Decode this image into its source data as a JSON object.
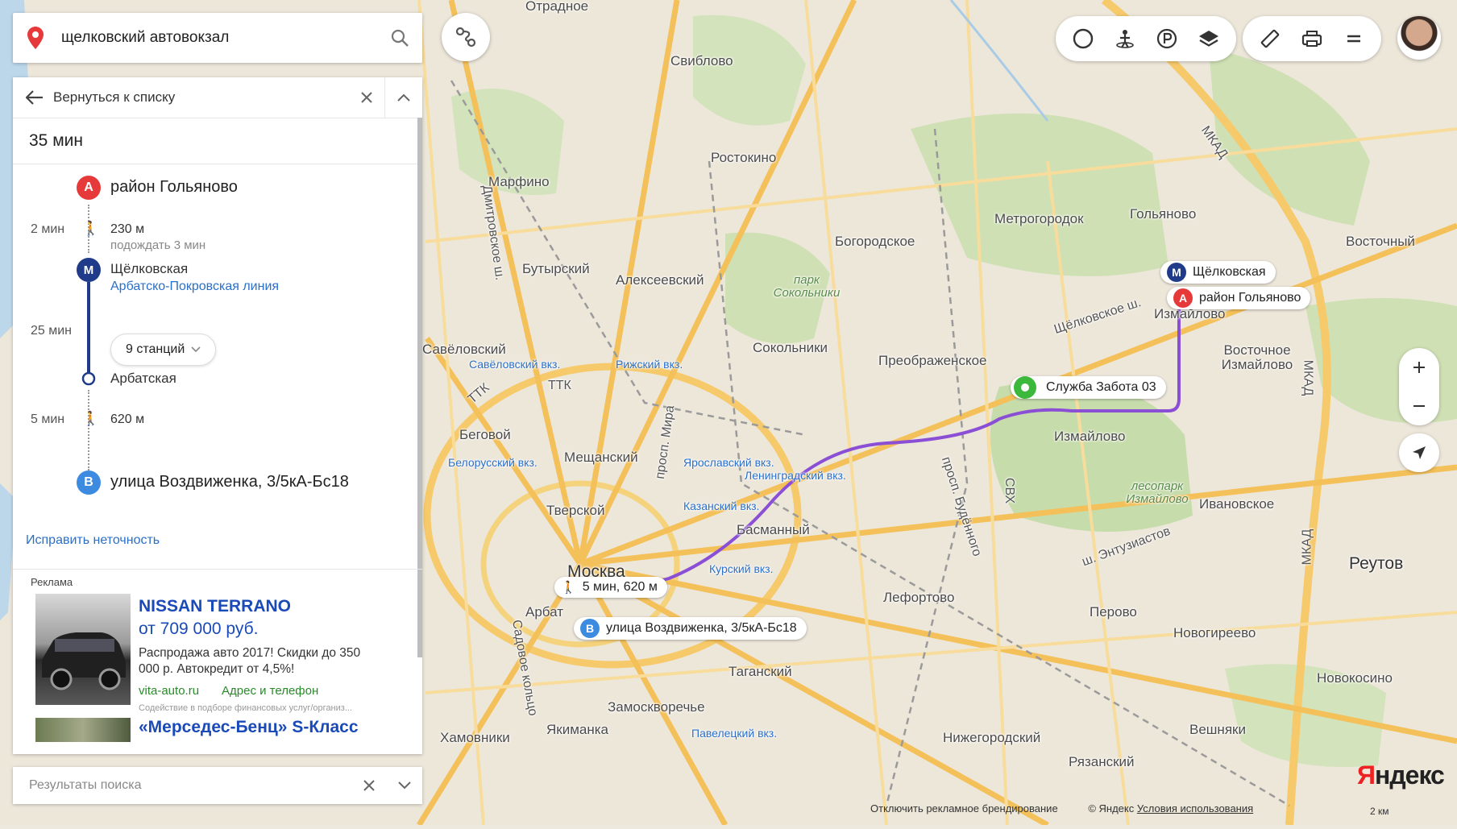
{
  "search": {
    "query": "щелковский автовокзал"
  },
  "panel": {
    "back_label": "Вернуться к списку",
    "duration": "35 мин",
    "origin": "район Гольяново",
    "origin_badge": "A",
    "walk1_time": "2 мин",
    "walk1_dist": "230 м",
    "walk1_wait": "подождать 3 мин",
    "metro_badge": "М",
    "metro_station": "Щёлковская",
    "metro_line": "Арбатско-Покровская линия",
    "ride_time": "25 мин",
    "stations_btn": "9 станций",
    "metro_exit": "Арбатская",
    "walk2_time": "5 мин",
    "walk2_dist": "620 м",
    "destination": "улица Воздвиженка, 3/5кА-Бс18",
    "destination_badge": "B",
    "fix_link": "Исправить неточность"
  },
  "ad": {
    "label": "Реклама",
    "title": "NISSAN TERRANO",
    "price": "от 709 000 руб.",
    "desc": "Распродажа авто 2017! Скидки до 350 000 р. Автокредит от 4,5%!",
    "site": "vita-auto.ru",
    "contact": "Адрес и телефон",
    "legal": "Содействие в подборе финансовых услуг/организ...",
    "title2": "«Мерседес-Бенц» S-Класс"
  },
  "results": {
    "placeholder": "Результаты поиска"
  },
  "map": {
    "markers": {
      "metro": "Щёлковская",
      "origin": "район Гольяново",
      "poi": "Служба Забота 03",
      "walk_info": "5 мин, 620 м",
      "destination": "улица Воздвиженка, 3/5кА-Бс18"
    },
    "labels": [
      {
        "key": "otradnoe",
        "text": "Отрадное"
      },
      {
        "key": "sviblovo",
        "text": "Свиблово"
      },
      {
        "key": "rostokino",
        "text": "Ростокино"
      },
      {
        "key": "marfino",
        "text": "Марфино"
      },
      {
        "key": "metrogorodok",
        "text": "Метрогородок"
      },
      {
        "key": "golyanovo",
        "text": "Гольяново"
      },
      {
        "key": "vostochny",
        "text": "Восточный"
      },
      {
        "key": "bogorodskoe",
        "text": "Богородское"
      },
      {
        "key": "butyrsky",
        "text": "Бутырский"
      },
      {
        "key": "alekseevsky",
        "text": "Алексеевский"
      },
      {
        "key": "sokolniki",
        "text": "Сокольники"
      },
      {
        "key": "preobrazhenskoe",
        "text": "Преображенское"
      },
      {
        "key": "izmaylovo1",
        "text": "Измайлово"
      },
      {
        "key": "vost_izm",
        "text": "Восточное Измайлово"
      },
      {
        "key": "savelovsky",
        "text": "Савёловский"
      },
      {
        "key": "begovoy",
        "text": "Беговой"
      },
      {
        "key": "meshchansky",
        "text": "Мещанский"
      },
      {
        "key": "izmaylovo2",
        "text": "Измайлово"
      },
      {
        "key": "basmanny",
        "text": "Басманный"
      },
      {
        "key": "tverskoy",
        "text": "Тверской"
      },
      {
        "key": "ivanovskoe",
        "text": "Ивановское"
      },
      {
        "key": "reutov",
        "text": "Реутов"
      },
      {
        "key": "lefortovo",
        "text": "Лефортово"
      },
      {
        "key": "perovo",
        "text": "Перово"
      },
      {
        "key": "novogireevo",
        "text": "Новогиреево"
      },
      {
        "key": "tagansky",
        "text": "Таганский"
      },
      {
        "key": "zamoskvorechye",
        "text": "Замоскворечье"
      },
      {
        "key": "yakimanka",
        "text": "Якиманка"
      },
      {
        "key": "khamovniki",
        "text": "Хамовники"
      },
      {
        "key": "nizhegorodsky",
        "text": "Нижегородский"
      },
      {
        "key": "veshnyaki",
        "text": "Вешняки"
      },
      {
        "key": "ryazansky",
        "text": "Рязанский"
      },
      {
        "key": "novokosino",
        "text": "Новокосино"
      },
      {
        "key": "moskva",
        "text": "Москва"
      },
      {
        "key": "arbat",
        "text": "Арбат"
      }
    ],
    "green_labels": [
      {
        "key": "park_sokolniki",
        "text": "парк Сокольники"
      },
      {
        "key": "lesopark",
        "text": "лесопарк Измайлово"
      }
    ],
    "roads": [
      {
        "key": "mkad1",
        "text": "МКАД"
      },
      {
        "key": "mkad2",
        "text": "МКАД"
      },
      {
        "key": "mkad3",
        "text": "МКАД"
      },
      {
        "key": "ttk1",
        "text": "ТТК"
      },
      {
        "key": "ttk2",
        "text": "ТТК"
      },
      {
        "key": "svh",
        "text": "СВХ"
      },
      {
        "key": "shchelk",
        "text": "Щёлковское ш."
      },
      {
        "key": "entuz",
        "text": "ш. Энтузиастов"
      },
      {
        "key": "mira",
        "text": "просп. Мира"
      },
      {
        "key": "budyonnogo",
        "text": "просп. Будённого"
      },
      {
        "key": "dmitrov",
        "text": "Дмитровское ш."
      },
      {
        "key": "sadovoe",
        "text": "Садовое кольцо"
      }
    ],
    "stations": [
      {
        "key": "savelovsky_vkz",
        "text": "Савёловский вкз."
      },
      {
        "key": "rizhsky",
        "text": "Рижский вкз."
      },
      {
        "key": "belorussky",
        "text": "Белорусский вкз."
      },
      {
        "key": "yaroslavsky",
        "text": "Ярославский вкз."
      },
      {
        "key": "leningradsky",
        "text": "Ленинградский вкз."
      },
      {
        "key": "kazansky",
        "text": "Казанский вкз."
      },
      {
        "key": "kursky",
        "text": "Курский вкз."
      },
      {
        "key": "paveletsky",
        "text": "Павелецкий вкз."
      }
    ]
  },
  "footer": {
    "ad_notice": "Отключить рекламное брендирование",
    "copyright": "© Яндекс",
    "terms": "Условия использования",
    "scale": "2 км"
  },
  "logo": {
    "y": "Я",
    "rest": "ндекс"
  },
  "colors": {
    "route": "#8b4fd6",
    "metro_line": "#1f3b8a",
    "origin_red": "#e63a3a",
    "dest_blue": "#3d8be0",
    "poi_green": "#3cb83c",
    "link": "#2a6fc9"
  }
}
